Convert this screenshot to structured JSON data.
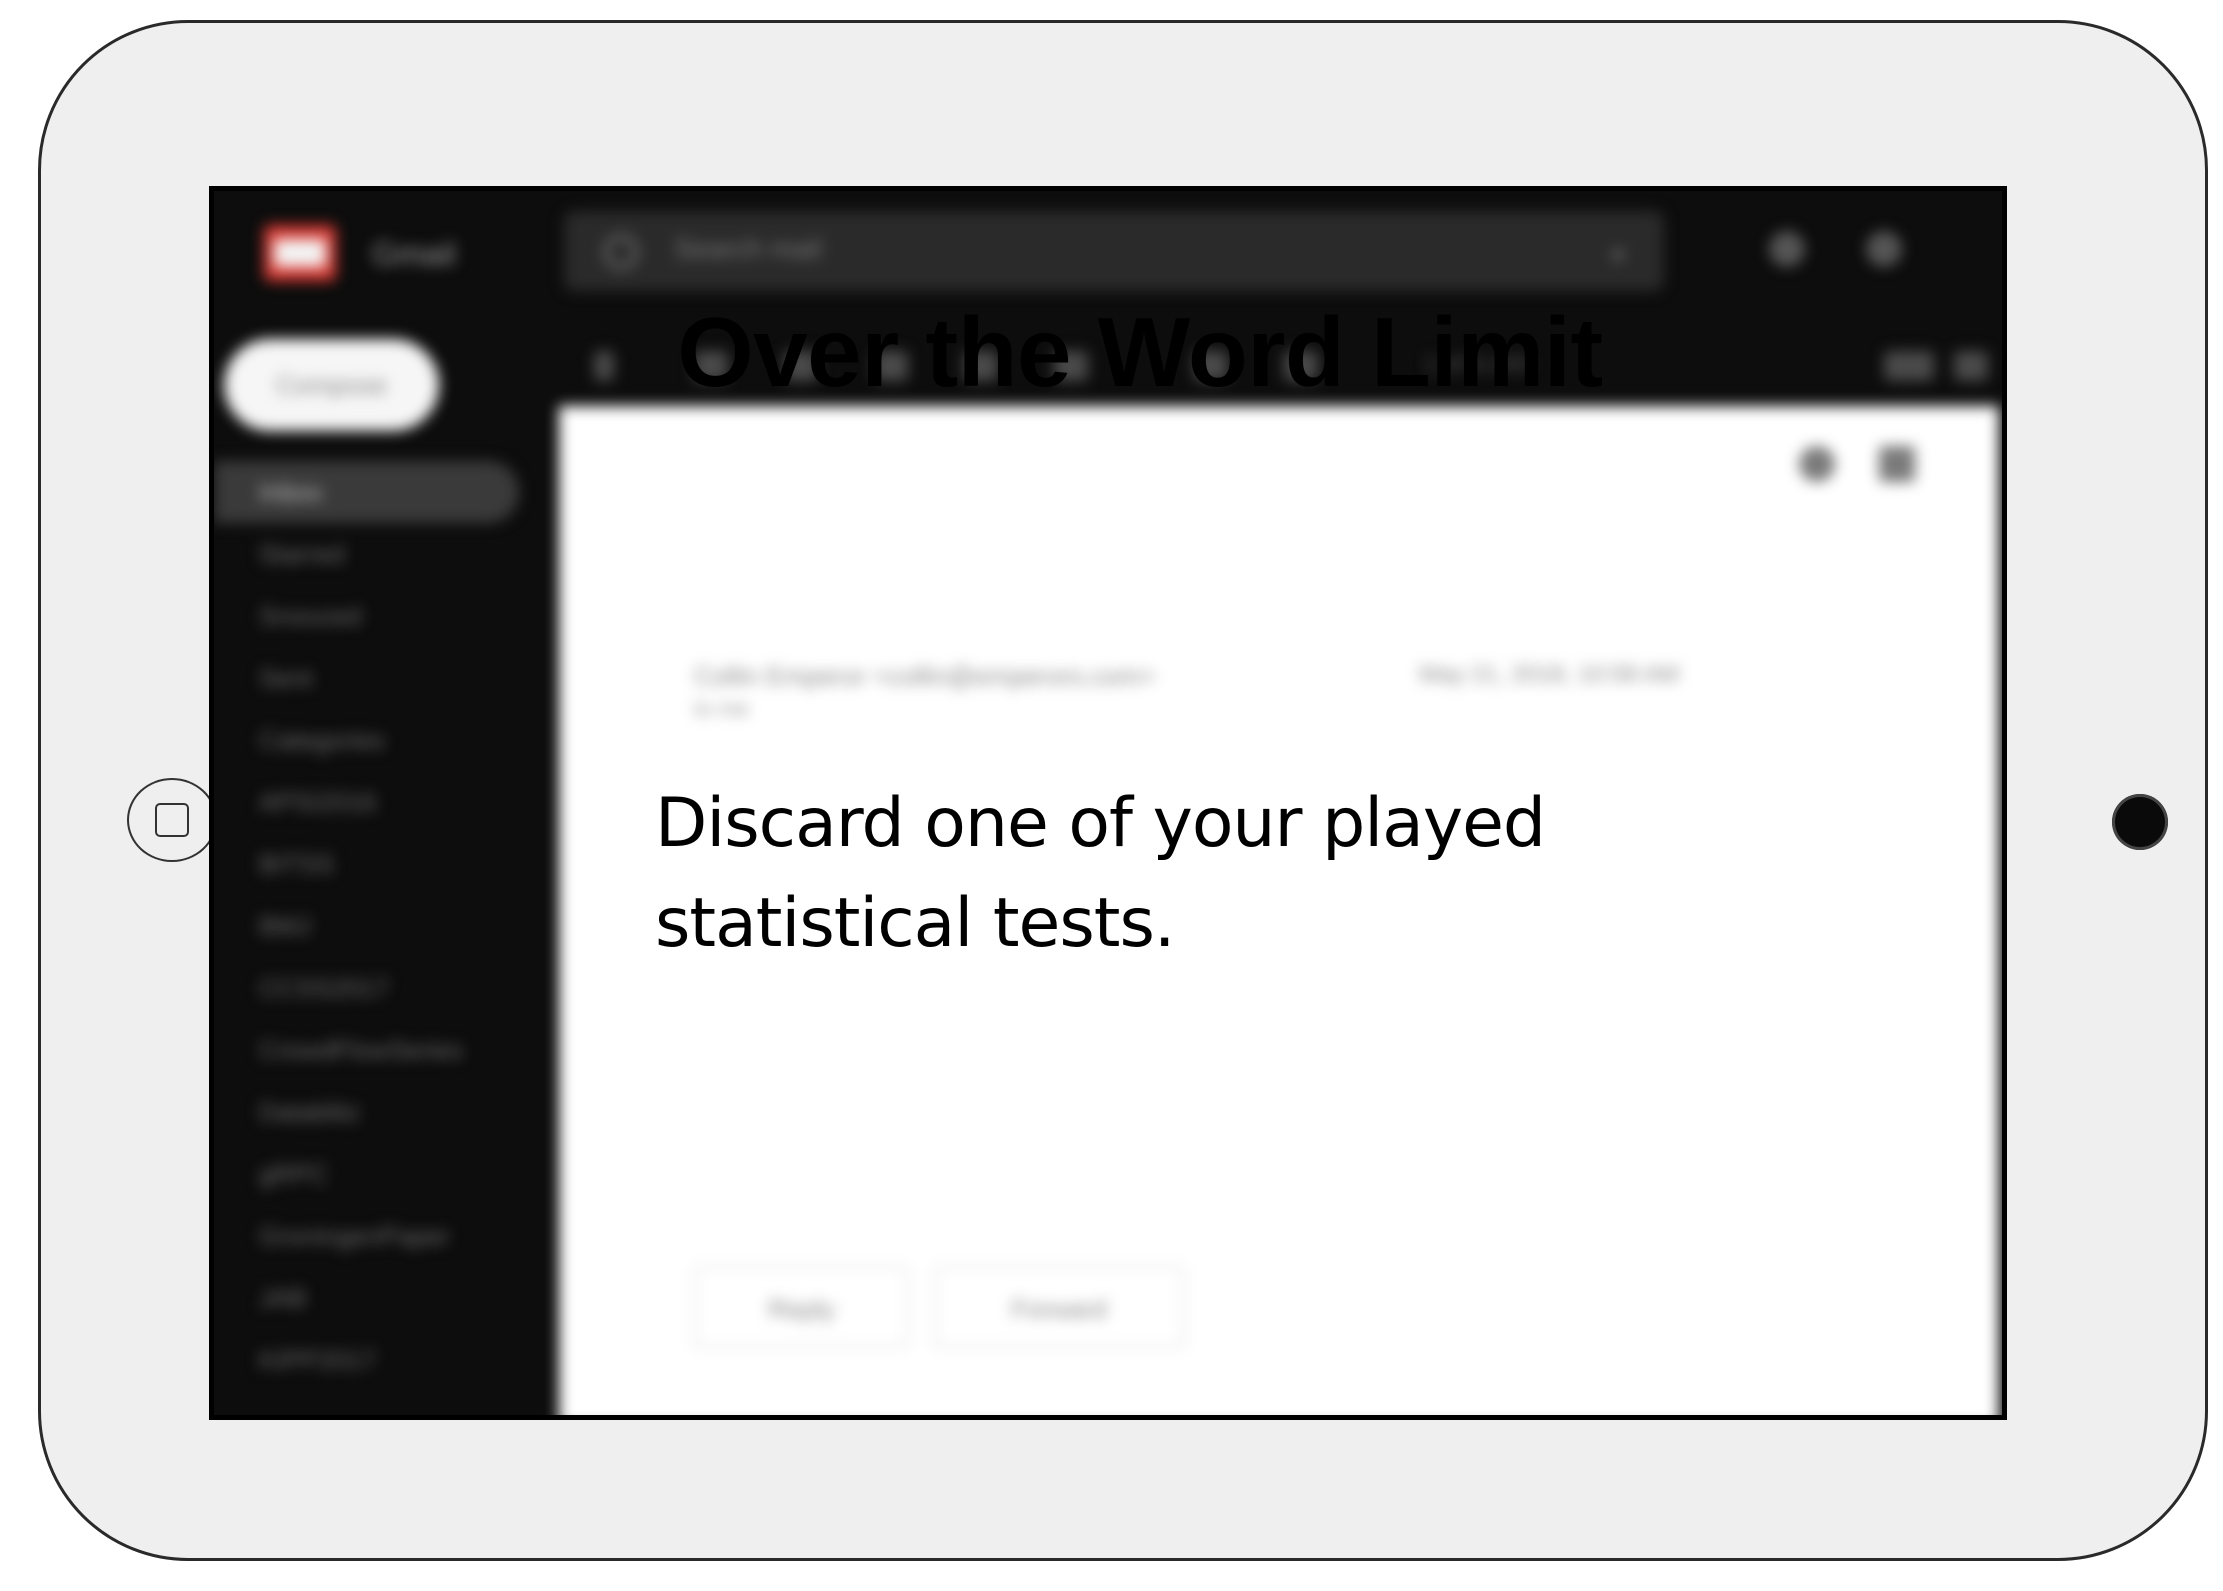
{
  "slide": {
    "title": "Over the Word Limit",
    "body_line_1": "Discard one of your played",
    "body_line_2": "statistical tests."
  },
  "background_app": {
    "app_name": "Gmail",
    "search": {
      "placeholder": "Search mail"
    },
    "compose_label": "Compose",
    "sidebar_items": [
      "Inbox",
      "Starred",
      "Snoozed",
      "Sent",
      "Categories",
      "APSI2016",
      "BITSS",
      "BMJ",
      "CCSS2017",
      "CrowdFlowSeries",
      "Datablitz",
      "gRPC",
      "GroningenPaper",
      "JAB",
      "KIPP2017"
    ],
    "toolbar": {
      "count_text": "1 of 6,400"
    },
    "message": {
      "sender": "Collin Emperor <collin@emperors.com>",
      "recipient": "to me",
      "date": "May 21, 2018, 10:58 AM",
      "reply_label": "Reply",
      "forward_label": "Forward"
    }
  },
  "colors": {
    "device_body": "#efefef",
    "screen_bg": "#0d0d0d",
    "gmail_red": "#d83a33"
  },
  "icons": [
    "home-button-icon",
    "camera-icon",
    "search-icon",
    "gmail-logo-icon"
  ]
}
